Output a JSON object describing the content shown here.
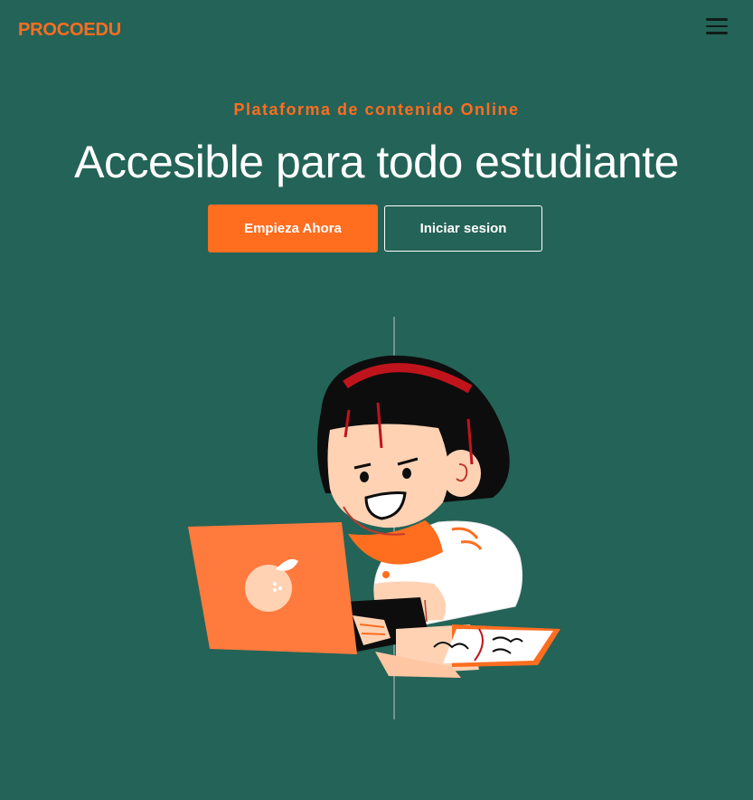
{
  "header": {
    "logo_text": "PROCOEDU",
    "menu_icon": "hamburger-menu-icon"
  },
  "hero": {
    "subtitle": "Plataforma de contenido Online",
    "title": "Accesible para todo estudiante",
    "primary_button": "Empieza Ahora",
    "secondary_button": "Iniciar sesion",
    "illustration": "girl-with-laptop-illustration"
  },
  "colors": {
    "background": "#246357",
    "accent": "#ff6d1f",
    "text": "#ffffff"
  }
}
